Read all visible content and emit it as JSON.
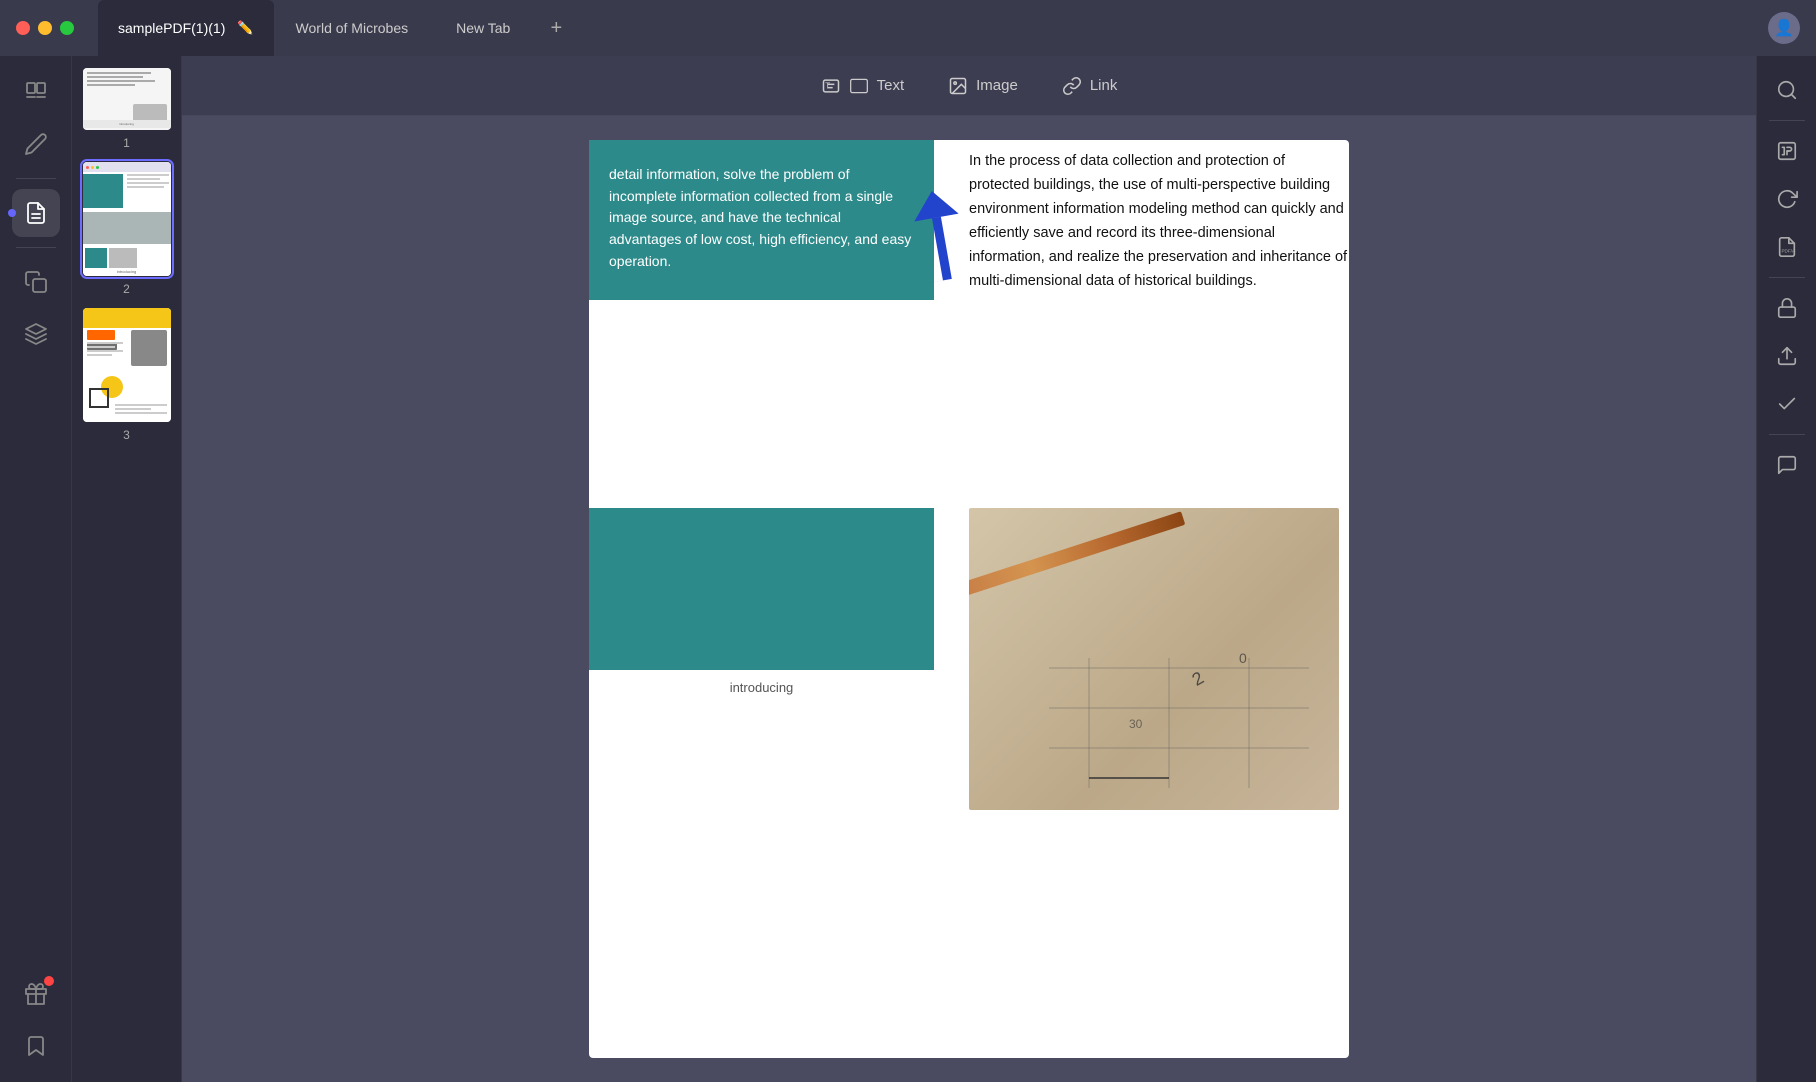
{
  "titlebar": {
    "tab1_label": "samplePDF(1)(1)",
    "tab2_label": "World of Microbes",
    "tab3_label": "New Tab",
    "add_tab_label": "+"
  },
  "toolbar": {
    "text_label": "Text",
    "image_label": "Image",
    "link_label": "Link"
  },
  "thumbnails": [
    {
      "num": "1"
    },
    {
      "num": "2"
    },
    {
      "num": "3"
    }
  ],
  "page_content": {
    "teal_text": "detail information, solve the problem of incomplete information collected from a single image source, and have the technical advantages of low cost, high efficiency, and easy operation.",
    "right_text": "In the process of data collection and protection of protected buildings, the use of multi-perspective building environment information modeling method can quickly and efficiently save and record its three-dimensional information, and realize the preservation and inheritance of multi-dimensional data of historical buildings.",
    "introducing": "introducing"
  },
  "sidebar_left": {
    "icons": [
      {
        "name": "book-icon",
        "title": "Reader"
      },
      {
        "name": "pen-icon",
        "title": "Annotate"
      },
      {
        "name": "duplicate-icon",
        "title": "Pages"
      },
      {
        "name": "layers-icon",
        "title": "Layers"
      },
      {
        "name": "gift-icon",
        "title": "Gift"
      },
      {
        "name": "bookmark-icon",
        "title": "Bookmark"
      }
    ]
  },
  "sidebar_right": {
    "icons": [
      {
        "name": "search-icon",
        "title": "Search"
      },
      {
        "name": "ocr-icon",
        "title": "OCR"
      },
      {
        "name": "rotate-icon",
        "title": "Rotate"
      },
      {
        "name": "pdf-a-icon",
        "title": "PDF/A"
      },
      {
        "name": "lock-icon",
        "title": "Security"
      },
      {
        "name": "share-icon",
        "title": "Share"
      },
      {
        "name": "check-icon",
        "title": "Validate"
      },
      {
        "name": "comment-icon",
        "title": "Comment"
      }
    ]
  }
}
